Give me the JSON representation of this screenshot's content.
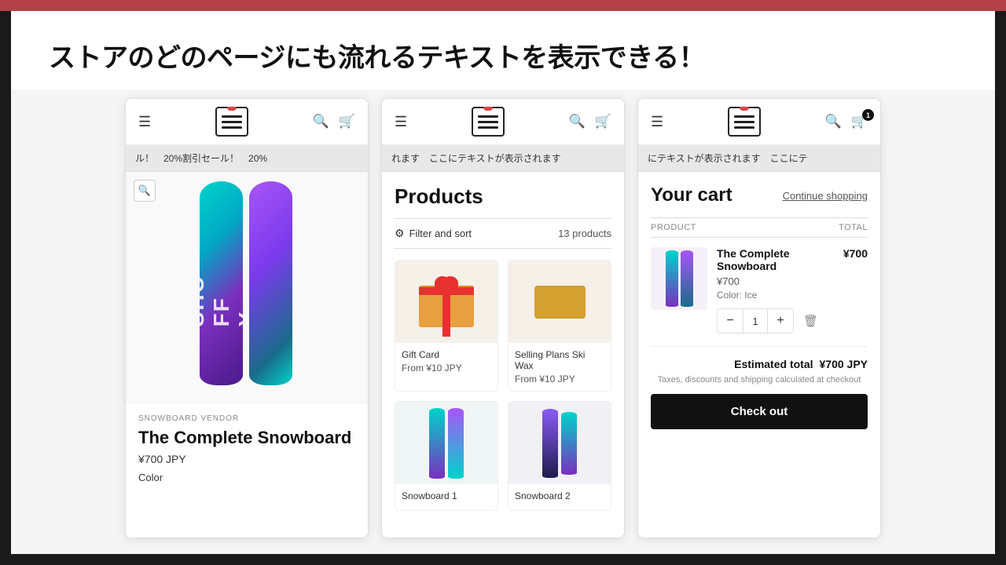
{
  "page": {
    "title": "ストアのどのページにも流れるテキストを表示できる！",
    "background": "#1a1a1a"
  },
  "panels": [
    {
      "id": "panel1",
      "type": "product-detail",
      "ticker": "ル！　20%割引セール！　20%",
      "product": {
        "vendor": "SNOWBOARD VENDOR",
        "name": "The Complete Snowboard",
        "price": "¥700 JPY",
        "color_label": "Color"
      }
    },
    {
      "id": "panel2",
      "type": "products",
      "ticker": "れます　ここにテキストが表示されます",
      "heading": "Products",
      "filter_label": "Filter and sort",
      "products_count": "13 products",
      "products": [
        {
          "name": "Gift Card",
          "price": "From ¥10 JPY"
        },
        {
          "name": "Selling Plans Ski Wax",
          "price": "From ¥10 JPY"
        },
        {
          "name": "Snowboard 1",
          "price": ""
        },
        {
          "name": "Snowboard 2",
          "price": ""
        }
      ]
    },
    {
      "id": "panel3",
      "type": "cart",
      "ticker": "にテキストが表示されます　ここにテ",
      "title": "Your cart",
      "continue_shopping": "Continue shopping",
      "columns": {
        "product": "PRODUCT",
        "total": "TOTAL"
      },
      "cart_item": {
        "name": "The Complete Snowboard",
        "price": "¥700",
        "variant": "Color: Ice",
        "quantity": "1",
        "line_total": "¥700"
      },
      "estimated_total_label": "Estimated total",
      "estimated_total_value": "¥700 JPY",
      "tax_note": "Taxes, discounts and shipping calculated at checkout",
      "checkout_label": "Check out"
    }
  ]
}
